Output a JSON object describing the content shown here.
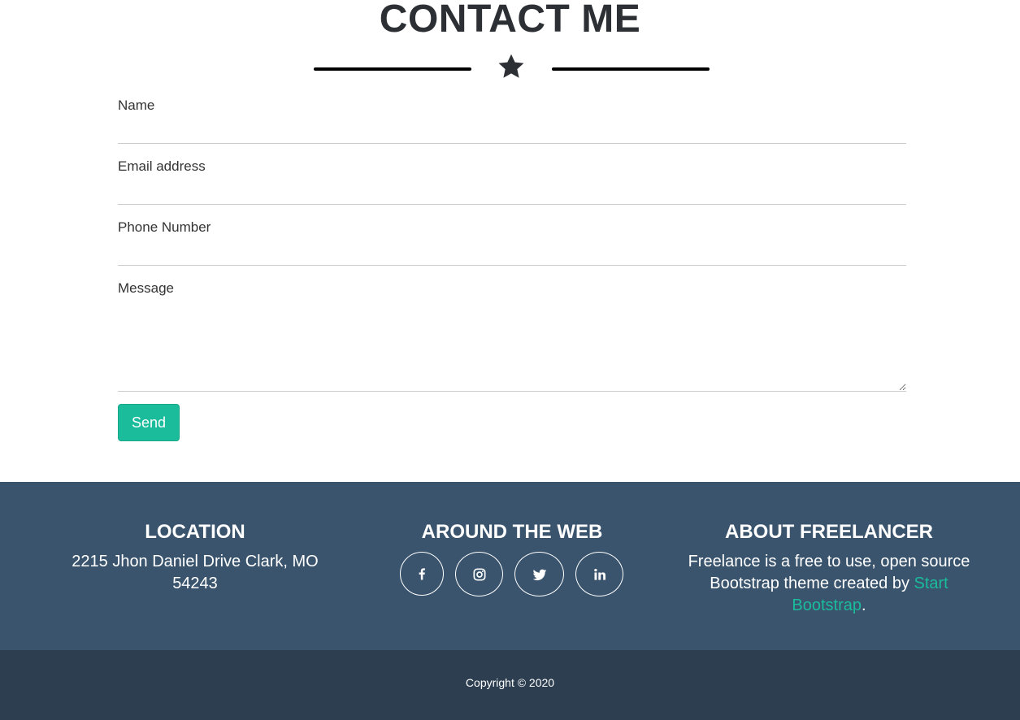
{
  "contact": {
    "title": "CONTACT ME",
    "divider_icon": "star-icon",
    "fields": {
      "name": {
        "label": "Name",
        "value": ""
      },
      "email": {
        "label": "Email address",
        "value": ""
      },
      "phone": {
        "label": "Phone Number",
        "value": ""
      },
      "message": {
        "label": "Message",
        "value": ""
      }
    },
    "send_label": "Send"
  },
  "footer": {
    "location": {
      "title": "LOCATION",
      "address": "2215 Jhon Daniel Drive Clark, MO 54243"
    },
    "around_the_web": {
      "title": "AROUND THE WEB",
      "links": [
        "facebook-icon",
        "instagram-icon",
        "twitter-icon",
        "linkedin-icon"
      ]
    },
    "about": {
      "title": "ABOUT FREELANCER",
      "text_before": "Freelance is a free to use, open source Bootstrap theme created by ",
      "link_text": "Start Bootstrap",
      "text_after": "."
    }
  },
  "copyright": "Copyright © 2020",
  "colors": {
    "accent": "#1abc9c",
    "footer_bg": "#3a546d",
    "copyright_bg": "#2c3e50",
    "heading": "#2c2f33"
  }
}
